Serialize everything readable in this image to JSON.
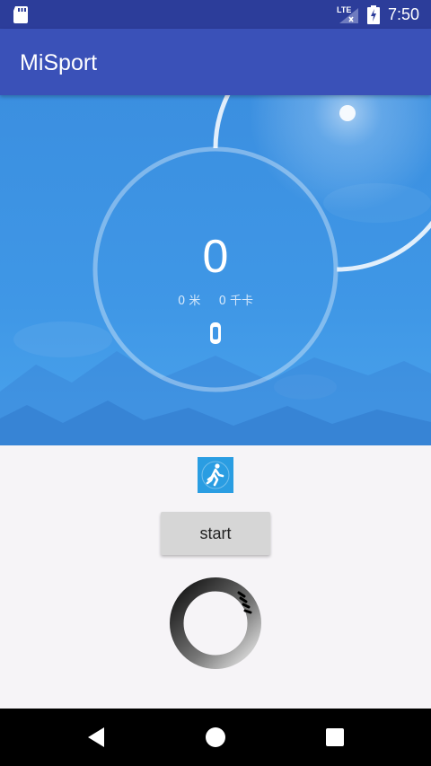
{
  "status_bar": {
    "time": "7:50",
    "network_label": "LTE",
    "icons": [
      "sd-card-icon",
      "lte-signal-icon",
      "battery-charging-icon"
    ]
  },
  "app_bar": {
    "title": "MiSport"
  },
  "hero": {
    "step_count": "0",
    "distance": "0 米",
    "calories": "0 千卡",
    "icon": "band-icon"
  },
  "main": {
    "activity_icon": "running-person-icon",
    "start_label": "start",
    "loading_icon": "spinner-icon"
  },
  "nav_bar": {
    "icons": [
      "back-icon",
      "home-icon",
      "recents-icon"
    ]
  },
  "colors": {
    "status_bar": "#2c3d9a",
    "app_bar": "#3a51b8",
    "hero": "#3f97e6",
    "button": "#d6d6d6",
    "background": "#f6f4f7"
  }
}
